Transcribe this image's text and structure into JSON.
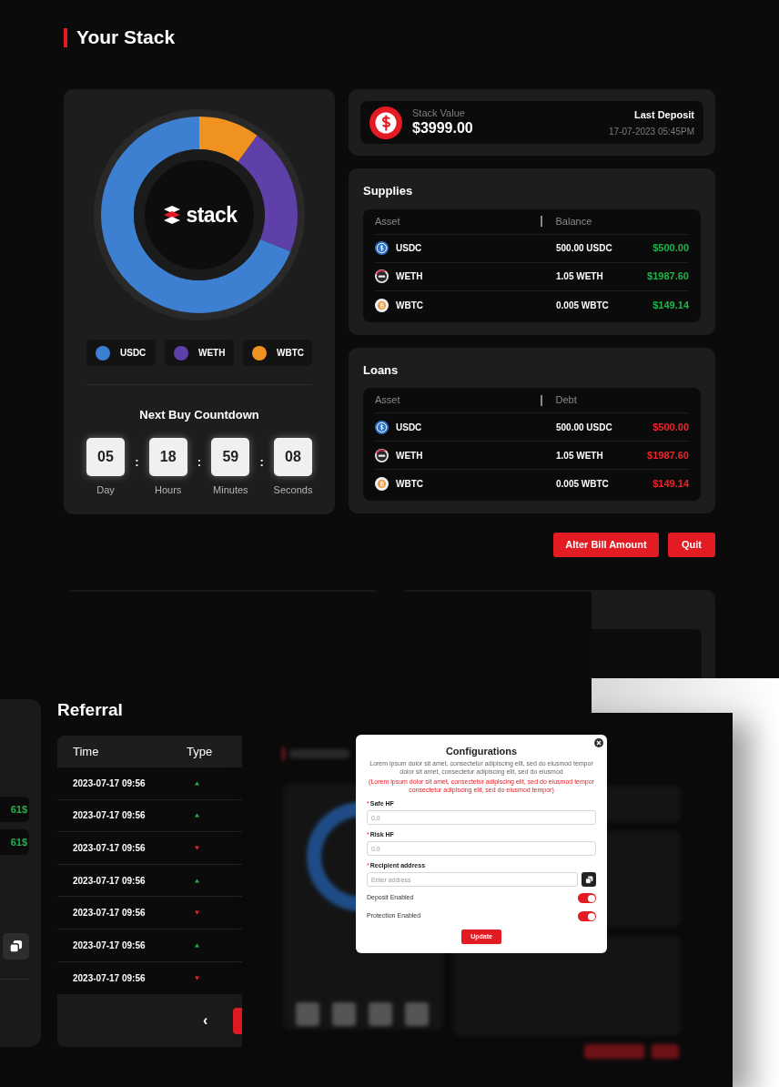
{
  "stack": {
    "title": "Your Stack",
    "logo": "stack",
    "legend": [
      {
        "label": "USDC",
        "color": "#3d7fd1"
      },
      {
        "label": "WETH",
        "color": "#5e40a8"
      },
      {
        "label": "WBTC",
        "color": "#f0921f"
      }
    ],
    "countdown": {
      "title": "Next Buy Countdown",
      "separator": ":",
      "units": [
        {
          "value": "05",
          "label": "Day"
        },
        {
          "value": "18",
          "label": "Hours"
        },
        {
          "value": "59",
          "label": "Minutes"
        },
        {
          "value": "08",
          "label": "Seconds"
        }
      ]
    },
    "stack_value": {
      "label": "Stack Value",
      "value": "$3999.00",
      "last_deposit_label": "Last Deposit",
      "last_deposit": "17-07-2023 05:45PM"
    },
    "tables": [
      {
        "title": "Supplies",
        "columns": [
          "Asset",
          "Balance"
        ],
        "kind": "supply",
        "rows": [
          {
            "asset": "USDC",
            "amount": "500.00 USDC",
            "value": "$500.00"
          },
          {
            "asset": "WETH",
            "amount": "1.05 WETH",
            "value": "$1987.60"
          },
          {
            "asset": "WBTC",
            "amount": "0.005 WBTC",
            "value": "$149.14"
          }
        ]
      },
      {
        "title": "Loans",
        "columns": [
          "Asset",
          "Debt"
        ],
        "kind": "loan",
        "rows": [
          {
            "asset": "USDC",
            "amount": "500.00 USDC",
            "value": "$500.00"
          },
          {
            "asset": "WETH",
            "amount": "1.05 WETH",
            "value": "$1987.60"
          },
          {
            "asset": "WBTC",
            "amount": "0.005 WBTC",
            "value": "$149.14"
          }
        ]
      }
    ],
    "buttons": [
      "Alter Bill Amount",
      "Quit"
    ]
  },
  "referral_screen": {
    "side_values": [
      "61$",
      "61$"
    ],
    "title": "Referral",
    "columns": [
      "Time",
      "Type"
    ],
    "rows": [
      {
        "time": "2023-07-17 09:56",
        "kind": "up"
      },
      {
        "time": "2023-07-17 09:56",
        "kind": "up"
      },
      {
        "time": "2023-07-17 09:56",
        "kind": "down"
      },
      {
        "time": "2023-07-17 09:56",
        "kind": "up"
      },
      {
        "time": "2023-07-17 09:56",
        "kind": "down"
      },
      {
        "time": "2023-07-17 09:56",
        "kind": "up"
      },
      {
        "time": "2023-07-17 09:56",
        "kind": "down"
      }
    ],
    "pager_prev": "‹"
  },
  "config_dialog": {
    "title": "Configurations",
    "description": "Lorem ipsum dolor sit amet, consectetur adipiscing elit, sed do eiusmod tempor dolor sit amet, consectetur adipiscing elit, sed do eiusmod",
    "warning": "(Lorem ipsum dolor sit amet, consectetur adipiscing elit, sed do eiusmod tempor consectetur adipiscing elit, sed do eiusmod tempor)",
    "fields": [
      {
        "label": "Safe HF",
        "required_mark": "*",
        "placeholder": "0.0",
        "kind": "number"
      },
      {
        "label": "Risk HF",
        "required_mark": "*",
        "placeholder": "0.0",
        "kind": "number"
      },
      {
        "label": "Recipient address",
        "required_mark": "*",
        "placeholder": "Enter address",
        "kind": "address"
      }
    ],
    "toggles": [
      {
        "label": "Deposit Enabled",
        "on": true
      },
      {
        "label": "Protection Enabled",
        "on": true
      }
    ],
    "submit": "Update"
  }
}
